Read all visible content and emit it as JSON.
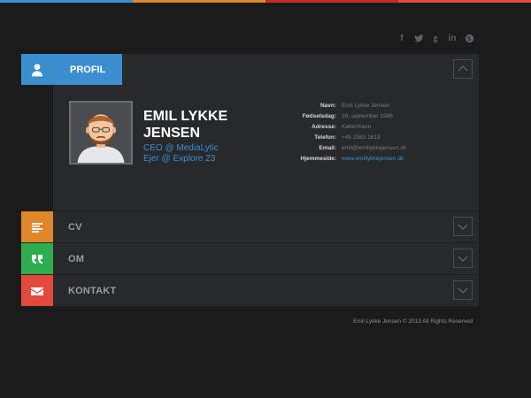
{
  "colors": {
    "accent_blue": "#3b8fd0",
    "cv_orange": "#e0872a",
    "om_green": "#2fae4f",
    "kontakt_red": "#e34a3c",
    "topbar": [
      "#3b8fd0",
      "#e0872a",
      "#c62a28",
      "#e34a3c"
    ]
  },
  "social": [
    {
      "name": "facebook-icon",
      "glyph": "f"
    },
    {
      "name": "twitter-icon",
      "glyph": ""
    },
    {
      "name": "google-plus-icon",
      "glyph": "g"
    },
    {
      "name": "linkedin-icon",
      "glyph": "in"
    },
    {
      "name": "skype-icon",
      "glyph": ""
    }
  ],
  "profile": {
    "tab_label": "PROFIL",
    "name": "EMIL LYKKE JENSEN",
    "role1": "CEO @ MediaLytic",
    "role2": "Ejer @ Explore 23",
    "info": [
      {
        "k": "Navn:",
        "v": "Emil Lykke Jensen"
      },
      {
        "k": "Fødselsdag:",
        "v": "16. september 1986"
      },
      {
        "k": "Adresse:",
        "v": "København"
      },
      {
        "k": "Telefon:",
        "v": "+45 2583 1619"
      },
      {
        "k": "Email:",
        "v": "emil@emillykkejensen.dk"
      },
      {
        "k": "Hjemmeside:",
        "v": "www.emillykkejensen.dk",
        "link": true
      }
    ]
  },
  "sections": [
    {
      "id": "cv",
      "label": "CV",
      "icon": "lines-icon"
    },
    {
      "id": "om",
      "label": "OM",
      "icon": "quote-icon"
    },
    {
      "id": "kontakt",
      "label": "KONTAKT",
      "icon": "envelope-icon"
    }
  ],
  "footer": "Emil Lykke Jensen © 2013 All Rights Reserved"
}
